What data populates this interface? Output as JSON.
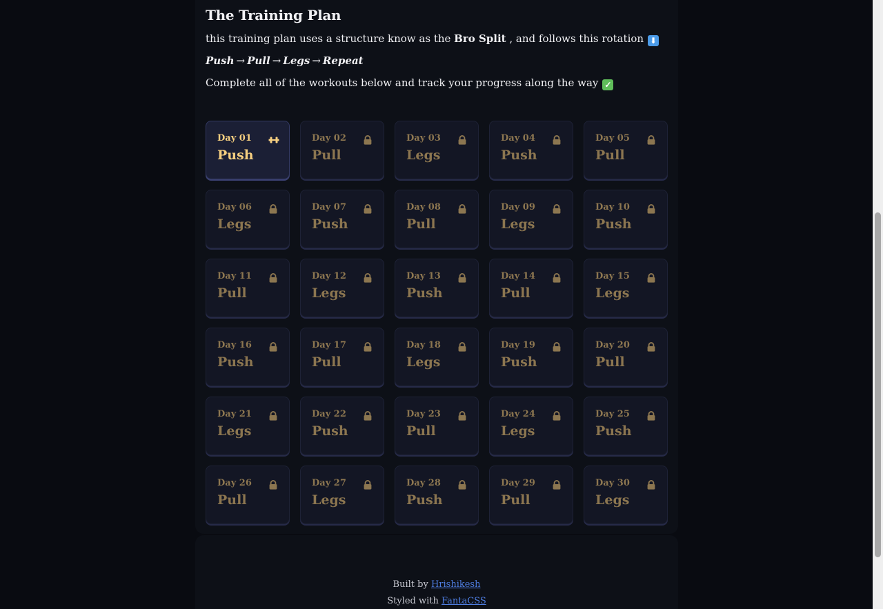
{
  "plan": {
    "title": "The Training Plan",
    "intro_before": "this training plan uses a structure know as the ",
    "intro_bold": "Bro Split",
    "intro_after": " , and follows this rotation",
    "rotation": [
      "Push",
      "Pull",
      "Legs",
      "Repeat"
    ],
    "arrow": "→",
    "complete_text": "Complete all of the workouts below and track your progress along the way",
    "emoji_down": "⬇",
    "emoji_check": "✓"
  },
  "days": [
    {
      "label": "Day 01",
      "name": "Push",
      "status": "active",
      "icon": "dumbbell-icon"
    },
    {
      "label": "Day 02",
      "name": "Pull",
      "status": "locked",
      "icon": "lock-icon"
    },
    {
      "label": "Day 03",
      "name": "Legs",
      "status": "locked",
      "icon": "lock-icon"
    },
    {
      "label": "Day 04",
      "name": "Push",
      "status": "locked",
      "icon": "lock-icon"
    },
    {
      "label": "Day 05",
      "name": "Pull",
      "status": "locked",
      "icon": "lock-icon"
    },
    {
      "label": "Day 06",
      "name": "Legs",
      "status": "locked",
      "icon": "lock-icon"
    },
    {
      "label": "Day 07",
      "name": "Push",
      "status": "locked",
      "icon": "lock-icon"
    },
    {
      "label": "Day 08",
      "name": "Pull",
      "status": "locked",
      "icon": "lock-icon"
    },
    {
      "label": "Day 09",
      "name": "Legs",
      "status": "locked",
      "icon": "lock-icon"
    },
    {
      "label": "Day 10",
      "name": "Push",
      "status": "locked",
      "icon": "lock-icon"
    },
    {
      "label": "Day 11",
      "name": "Pull",
      "status": "locked",
      "icon": "lock-icon"
    },
    {
      "label": "Day 12",
      "name": "Legs",
      "status": "locked",
      "icon": "lock-icon"
    },
    {
      "label": "Day 13",
      "name": "Push",
      "status": "locked",
      "icon": "lock-icon"
    },
    {
      "label": "Day 14",
      "name": "Pull",
      "status": "locked",
      "icon": "lock-icon"
    },
    {
      "label": "Day 15",
      "name": "Legs",
      "status": "locked",
      "icon": "lock-icon"
    },
    {
      "label": "Day 16",
      "name": "Push",
      "status": "locked",
      "icon": "lock-icon"
    },
    {
      "label": "Day 17",
      "name": "Pull",
      "status": "locked",
      "icon": "lock-icon"
    },
    {
      "label": "Day 18",
      "name": "Legs",
      "status": "locked",
      "icon": "lock-icon"
    },
    {
      "label": "Day 19",
      "name": "Push",
      "status": "locked",
      "icon": "lock-icon"
    },
    {
      "label": "Day 20",
      "name": "Pull",
      "status": "locked",
      "icon": "lock-icon"
    },
    {
      "label": "Day 21",
      "name": "Legs",
      "status": "locked",
      "icon": "lock-icon"
    },
    {
      "label": "Day 22",
      "name": "Push",
      "status": "locked",
      "icon": "lock-icon"
    },
    {
      "label": "Day 23",
      "name": "Pull",
      "status": "locked",
      "icon": "lock-icon"
    },
    {
      "label": "Day 24",
      "name": "Legs",
      "status": "locked",
      "icon": "lock-icon"
    },
    {
      "label": "Day 25",
      "name": "Push",
      "status": "locked",
      "icon": "lock-icon"
    },
    {
      "label": "Day 26",
      "name": "Pull",
      "status": "locked",
      "icon": "lock-icon"
    },
    {
      "label": "Day 27",
      "name": "Legs",
      "status": "locked",
      "icon": "lock-icon"
    },
    {
      "label": "Day 28",
      "name": "Push",
      "status": "locked",
      "icon": "lock-icon"
    },
    {
      "label": "Day 29",
      "name": "Pull",
      "status": "locked",
      "icon": "lock-icon"
    },
    {
      "label": "Day 30",
      "name": "Legs",
      "status": "locked",
      "icon": "lock-icon"
    }
  ],
  "footer": {
    "built_by": "Built by",
    "author_link": "Hrishikesh",
    "styled_with": "Styled with",
    "css_link": "FantaCSS"
  },
  "colors": {
    "page_background": "#090b11",
    "panel_background": "#0d1017",
    "card_background": "#131624",
    "active_card_background": "#1b1f35",
    "locked_text": "#8c7650",
    "active_text": "#f6cf80",
    "link": "#4e7de0"
  }
}
